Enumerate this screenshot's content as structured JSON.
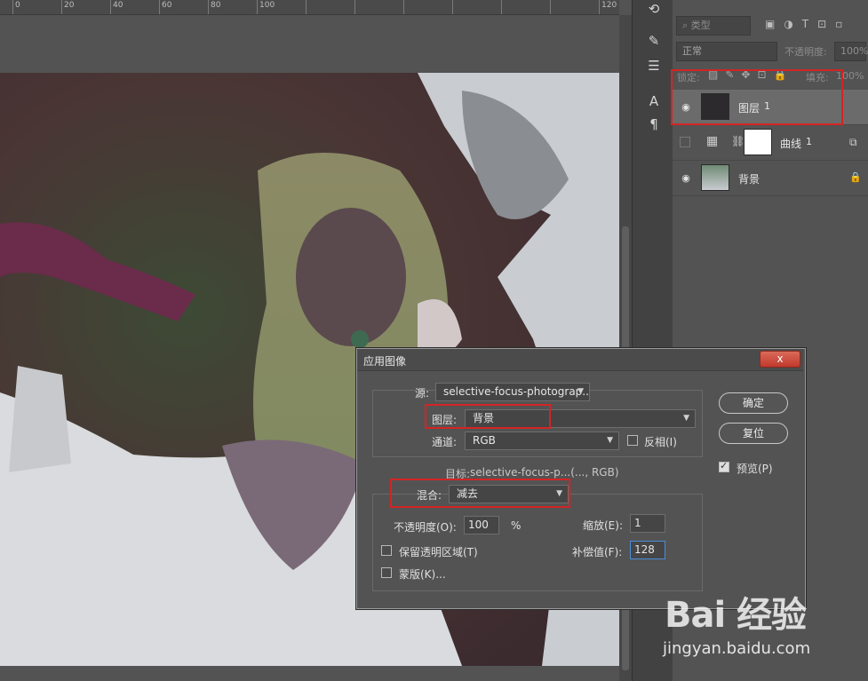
{
  "ruler": {
    "labels": [
      "0",
      "20",
      "40",
      "60",
      "80",
      "100",
      "120"
    ]
  },
  "layers_panel": {
    "filter_kind": "类型",
    "blend_mode": "正常",
    "opacity_label": "不透明度:",
    "opacity_value": "100%",
    "lock_label": "锁定:",
    "fill_label": "填充:",
    "fill_value": "100%",
    "layers": [
      {
        "name": "图层",
        "suffix": "1",
        "visible": true,
        "selected": true
      },
      {
        "name": "曲线",
        "suffix": "1",
        "visible": false,
        "selected": false
      },
      {
        "name": "背景",
        "suffix": "",
        "visible": true,
        "selected": false
      }
    ]
  },
  "dialog": {
    "title": "应用图像",
    "close_label": "x",
    "source_label": "源:",
    "source_value": "selective-focus-photograp...",
    "layer_label": "图层:",
    "layer_value": "背景",
    "channel_label": "通道:",
    "channel_value": "RGB",
    "invert_label": "反相(I)",
    "target_label": "目标:",
    "target_value": "selective-focus-p...(..., RGB)",
    "blending_label": "混合:",
    "blending_value": "减去",
    "opacity_label": "不透明度(O):",
    "opacity_value": "100",
    "percent": "%",
    "scale_label": "缩放(E):",
    "scale_value": "1",
    "offset_label": "补偿值(F):",
    "offset_value": "128",
    "preserve_label": "保留透明区域(T)",
    "mask_label": "蒙版(K)...",
    "ok_label": "确定",
    "reset_label": "复位",
    "preview_label": "预览(P)",
    "preview_checked": true
  },
  "watermark": {
    "logo": "Bai 经验",
    "url": "jingyan.baidu.com"
  },
  "colors": {
    "highlight_red": "#d42424",
    "focus_blue": "#4a8ed8"
  }
}
